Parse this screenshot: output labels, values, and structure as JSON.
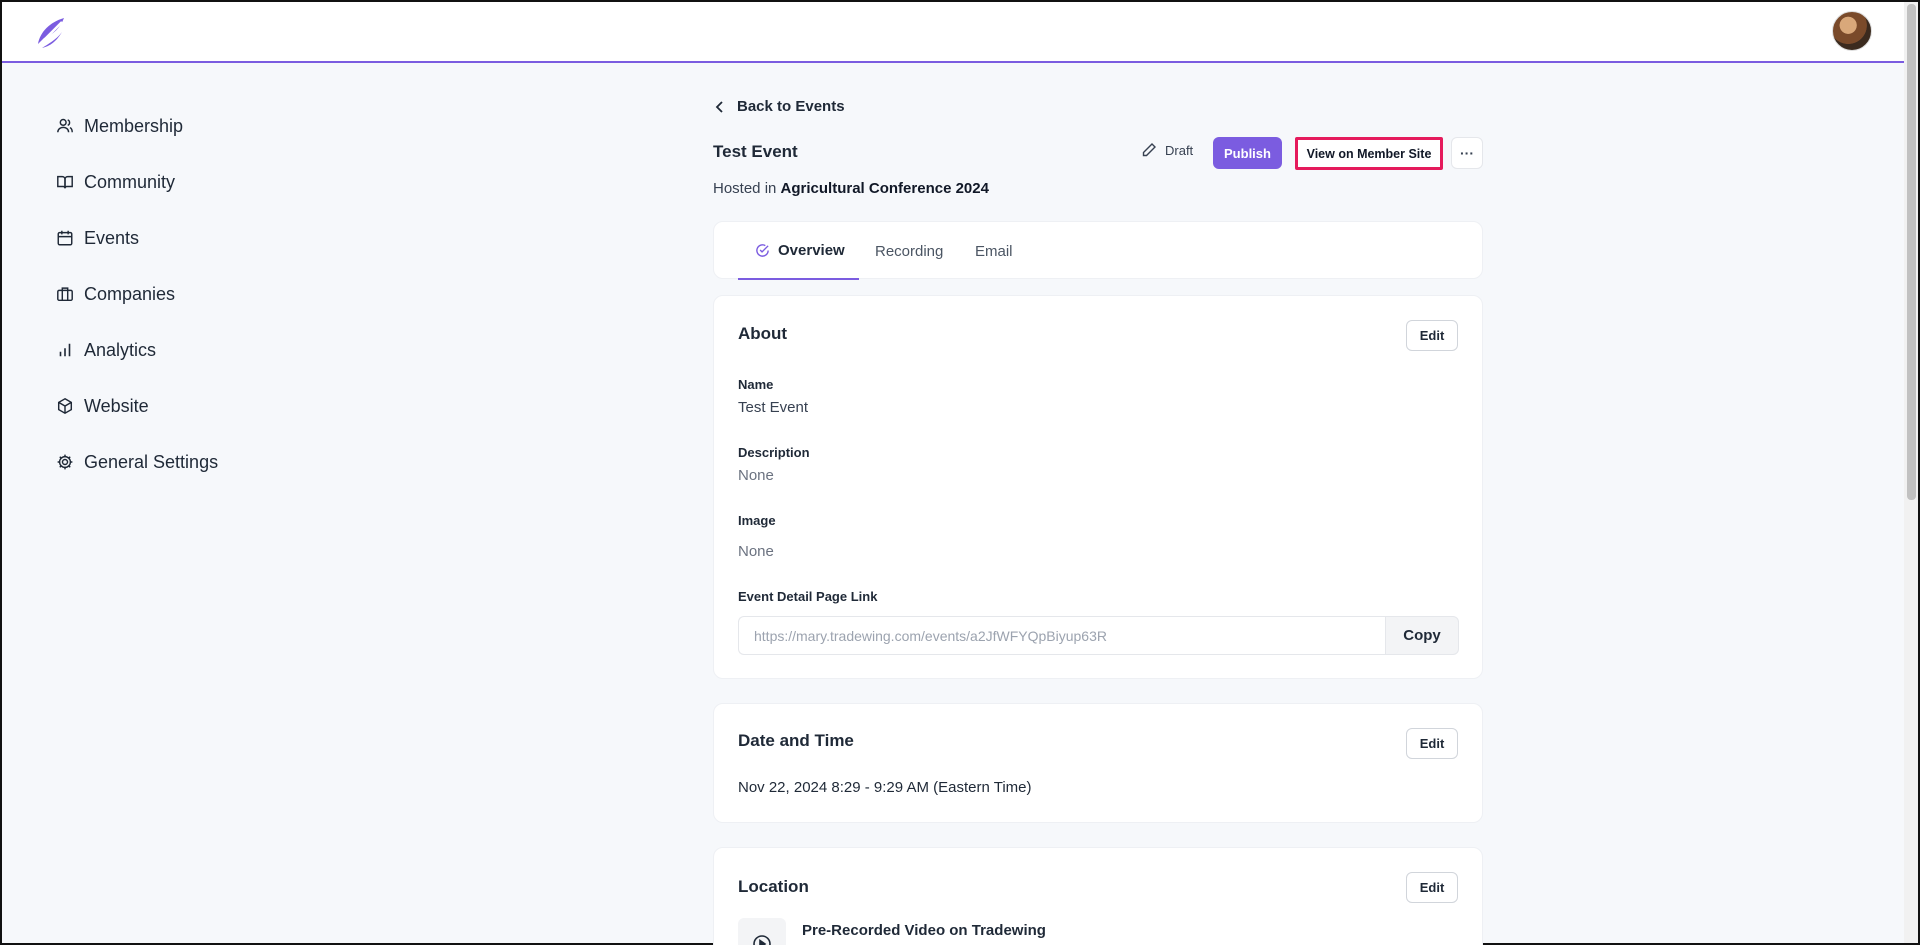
{
  "header": {
    "logo": "leaf-logo-icon",
    "avatar": "user-avatar"
  },
  "sidebar": {
    "items": [
      {
        "label": "Membership",
        "icon": "users-icon"
      },
      {
        "label": "Community",
        "icon": "book-icon"
      },
      {
        "label": "Events",
        "icon": "calendar-icon"
      },
      {
        "label": "Companies",
        "icon": "briefcase-icon"
      },
      {
        "label": "Analytics",
        "icon": "bar-chart-icon"
      },
      {
        "label": "Website",
        "icon": "cube-icon"
      },
      {
        "label": "General Settings",
        "icon": "gear-icon"
      }
    ]
  },
  "main": {
    "back_label": "Back to Events",
    "title": "Test Event",
    "hosted_prefix": "Hosted in",
    "hosted_name": "Agricultural Conference 2024",
    "draft_label": "Draft",
    "publish_label": "Publish",
    "view_member_site_label": "View on Member Site",
    "more_label": "···",
    "tabs": [
      {
        "label": "Overview",
        "active": true
      },
      {
        "label": "Recording",
        "active": false
      },
      {
        "label": "Email",
        "active": false
      }
    ],
    "about": {
      "title": "About",
      "edit_label": "Edit",
      "name_label": "Name",
      "name_value": "Test Event",
      "description_label": "Description",
      "description_value": "None",
      "image_label": "Image",
      "image_value": "None",
      "link_label": "Event Detail Page Link",
      "link_value": "https://mary.tradewing.com/events/a2JfWFYQpBiyup63R",
      "copy_label": "Copy"
    },
    "datetime": {
      "title": "Date and Time",
      "edit_label": "Edit",
      "value": "Nov 22, 2024 8:29 - 9:29 AM (Eastern Time)"
    },
    "location": {
      "title": "Location",
      "edit_label": "Edit",
      "type_label": "Pre-Recorded Video on Tradewing"
    }
  },
  "colors": {
    "accent": "#7b5ce0",
    "highlight": "#e51a5c",
    "background": "#f6f8fb"
  }
}
